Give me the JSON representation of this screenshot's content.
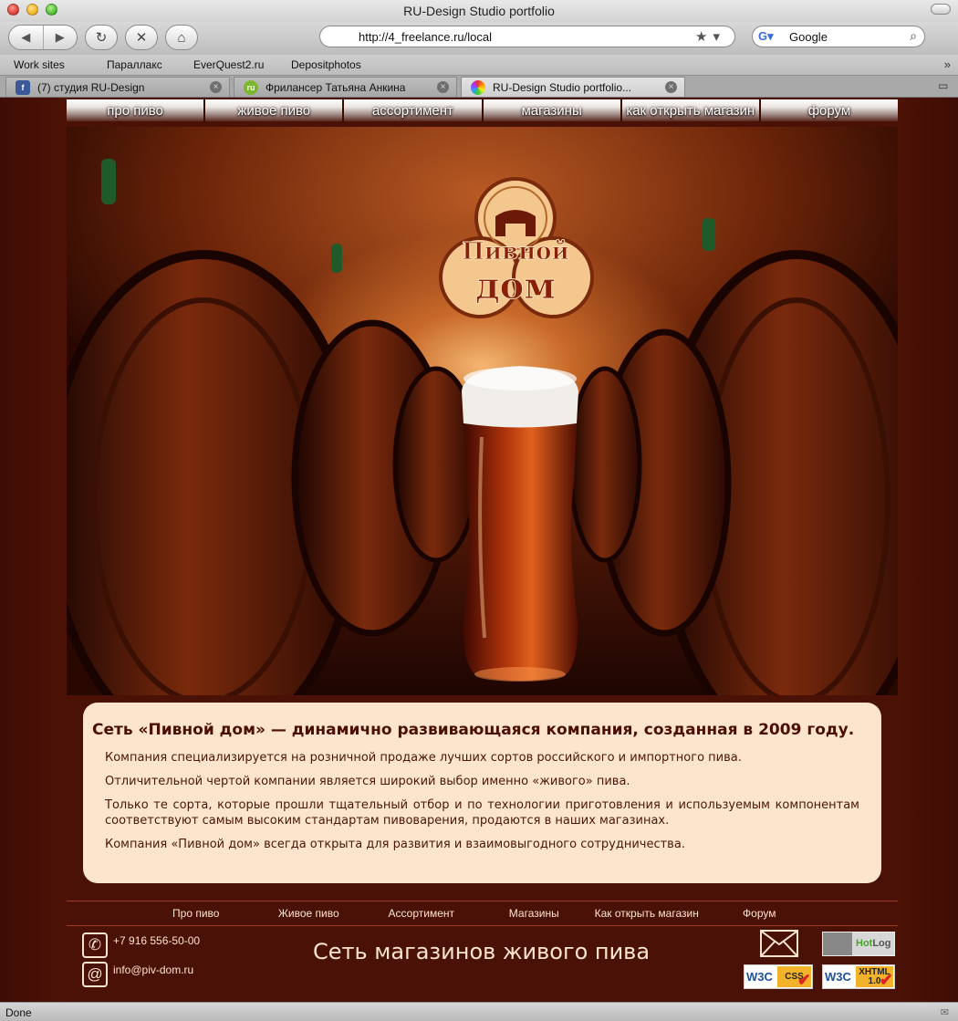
{
  "browser": {
    "window_title": "RU-Design Studio portfolio",
    "url": "http://4_freelance.ru/local",
    "search_engine": "Google",
    "search_value": "Google",
    "bookmarks": [
      "Work sites",
      "Параллакс",
      "EverQuest2.ru",
      "Depositphotos"
    ],
    "tabs": [
      {
        "title": "(7) студия RU-Design",
        "favicon": "facebook-icon",
        "fav_label": "f",
        "fav_color": "#3b5998"
      },
      {
        "title": "Фрилансер Татьяна Анкина",
        "favicon": "freelance-ru-icon",
        "fav_label": "ru",
        "fav_color": "#7cb82f"
      },
      {
        "title": "RU-Design Studio portfolio...",
        "favicon": "ru-design-icon",
        "fav_label": "",
        "fav_color": "#d03a8a",
        "active": true
      }
    ],
    "status": "Done"
  },
  "site": {
    "menu": [
      "про пиво",
      "живое пиво",
      "ассортимент",
      "магазины",
      "как открыть магазин",
      "форум"
    ],
    "logo": {
      "line1": "Пивной",
      "line2": "дом"
    },
    "intro": {
      "heading": "Сеть «Пивной дом» — динамично развивающаяся компания, созданная в 2009 году.",
      "paragraphs": [
        "Компания специализируется на розничной продаже лучших сортов российского и импортного пива.",
        "Отличительной чертой компании является широкий выбор именно «живого» пива.",
        "Только те сорта, которые прошли тщательный отбор и по технологии приготовления и используемым компонентам соответствуют самым высоким стандартам пивоварения, продаются в наших магазинах.",
        "Компания «Пивной дом» всегда открыта для развития и взаимовыгодного сотрудничества."
      ]
    },
    "footer_nav": [
      "Про пиво",
      "Живое пиво",
      "Ассортимент",
      "Магазины",
      "Как открыть магазин",
      "Форум"
    ],
    "phone": "+7 916 556-50-00",
    "email": "info@piv-dom.ru",
    "slogan": "Сеть магазинов живого пива",
    "badges": {
      "hotlog": {
        "hot": "Hot",
        "log": "Log"
      },
      "w3c_css": {
        "w3c": "W3C",
        "label": "CSS"
      },
      "w3c_xhtml": {
        "w3c": "W3C",
        "label": "XHTML",
        "version": "1.0"
      }
    }
  }
}
